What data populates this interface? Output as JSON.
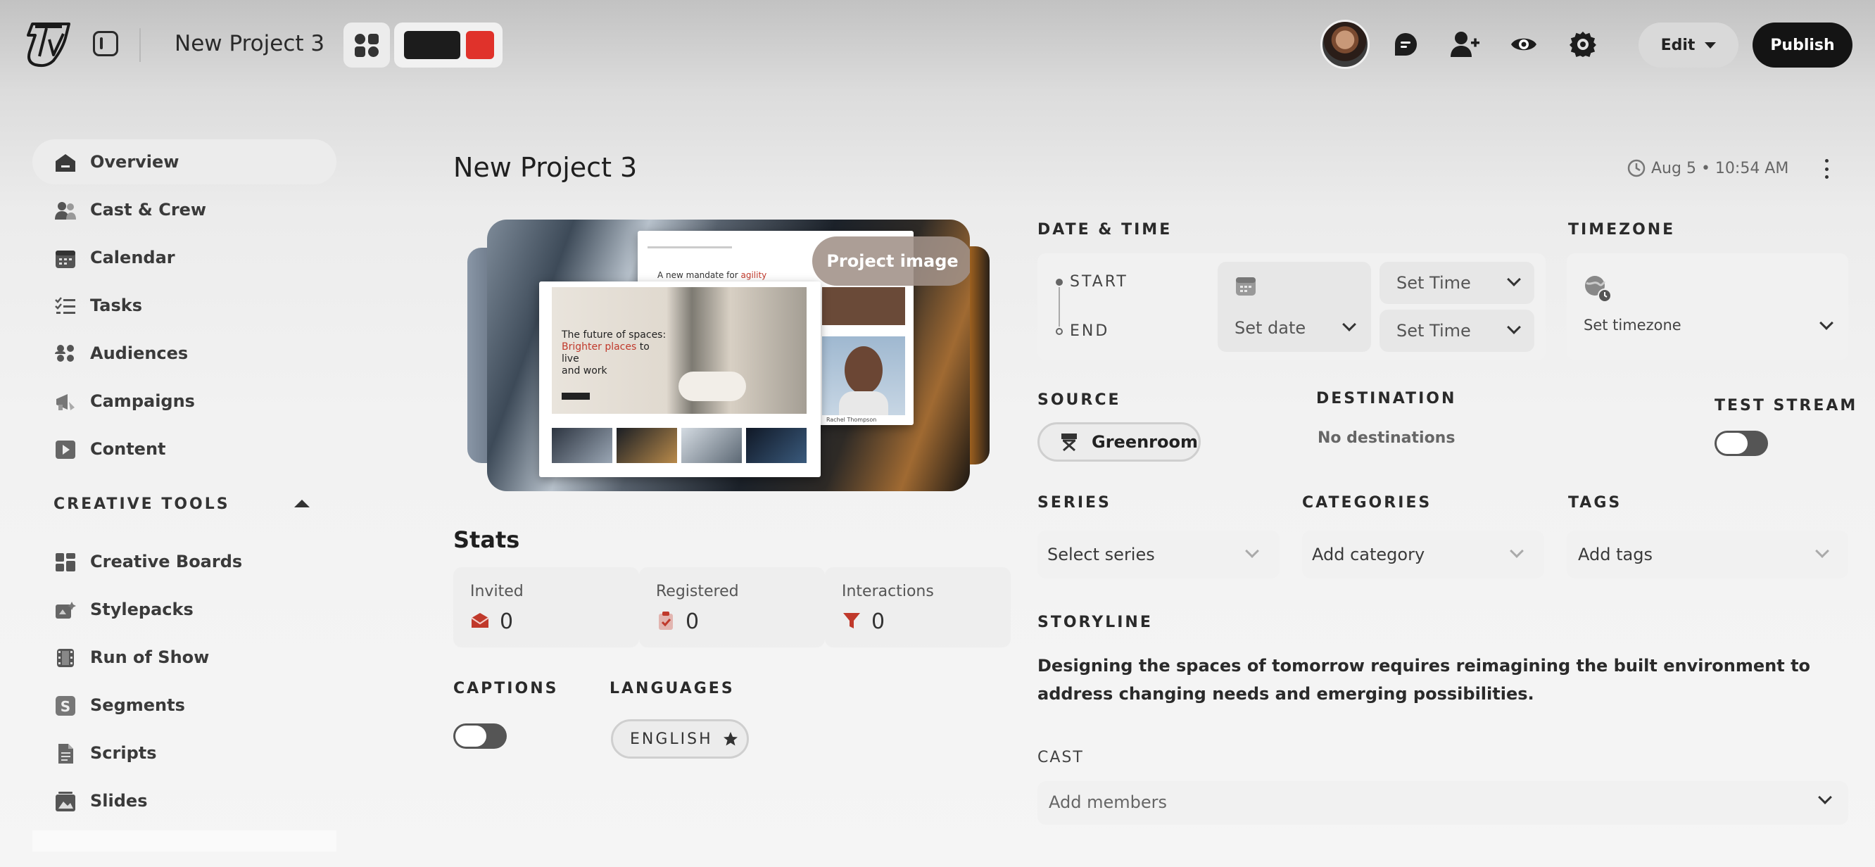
{
  "header": {
    "project_name": "New Project 3",
    "edit_label": "Edit",
    "publish_label": "Publish"
  },
  "theme": {
    "swatch_dark": "#1c1c1c",
    "swatch_red": "#e0322b"
  },
  "sidebar": {
    "items": [
      {
        "label": "Overview",
        "icon": "home-icon"
      },
      {
        "label": "Cast & Crew",
        "icon": "people-icon"
      },
      {
        "label": "Calendar",
        "icon": "calendar-icon"
      },
      {
        "label": "Tasks",
        "icon": "checklist-icon"
      },
      {
        "label": "Audiences",
        "icon": "audience-icon"
      },
      {
        "label": "Campaigns",
        "icon": "megaphone-icon"
      },
      {
        "label": "Content",
        "icon": "play-icon"
      }
    ],
    "creative_tools_title": "CREATIVE TOOLS",
    "creative_tools": [
      {
        "label": "Creative Boards",
        "icon": "boards-icon"
      },
      {
        "label": "Stylepacks",
        "icon": "stylepack-icon"
      },
      {
        "label": "Run of Show",
        "icon": "film-icon"
      },
      {
        "label": "Segments",
        "icon": "segments-icon"
      },
      {
        "label": "Scripts",
        "icon": "script-icon"
      },
      {
        "label": "Slides",
        "icon": "slides-icon"
      }
    ]
  },
  "main": {
    "title": "New Project 3",
    "timestamp": "Aug 5 • 10:54 AM",
    "project_image_label": "Project image",
    "preview": {
      "headline_1": "The future of spaces:",
      "headline_2": "Brighter places",
      "headline_3": " to live",
      "headline_4": "and work",
      "card_title": "A new mandate for ",
      "card_title_accent": "agility",
      "person_name": "Rachel Thompson"
    },
    "stats": {
      "title": "Stats",
      "items": [
        {
          "label": "Invited",
          "value": "0",
          "icon": "envelope-icon",
          "color": "#c0392b"
        },
        {
          "label": "Registered",
          "value": "0",
          "icon": "clipboard-check-icon",
          "color": "#c0392b"
        },
        {
          "label": "Interactions",
          "value": "0",
          "icon": "funnel-icon",
          "color": "#c0392b"
        }
      ]
    },
    "captions_label": "CAPTIONS",
    "languages_label": "LANGUAGES",
    "language_value": "ENGLISH",
    "date_time": {
      "label": "DATE & TIME",
      "start_label": "START",
      "end_label": "END",
      "date_placeholder": "Set date",
      "time_placeholder": "Set Time"
    },
    "timezone": {
      "label": "TIMEZONE",
      "placeholder": "Set timezone"
    },
    "source": {
      "label": "SOURCE",
      "value": "Greenroom"
    },
    "destination": {
      "label": "DESTINATION",
      "value": "No destinations"
    },
    "test_stream_label": "TEST STREAM",
    "series": {
      "label": "SERIES",
      "placeholder": "Select series"
    },
    "categories": {
      "label": "CATEGORIES",
      "placeholder": "Add category"
    },
    "tags": {
      "label": "TAGS",
      "placeholder": "Add tags"
    },
    "storyline": {
      "label": "STORYLINE",
      "text": "Designing the spaces of tomorrow requires reimagining the built environment to address changing needs and emerging possibilities."
    },
    "cast": {
      "label": "CAST",
      "placeholder": "Add members"
    }
  }
}
